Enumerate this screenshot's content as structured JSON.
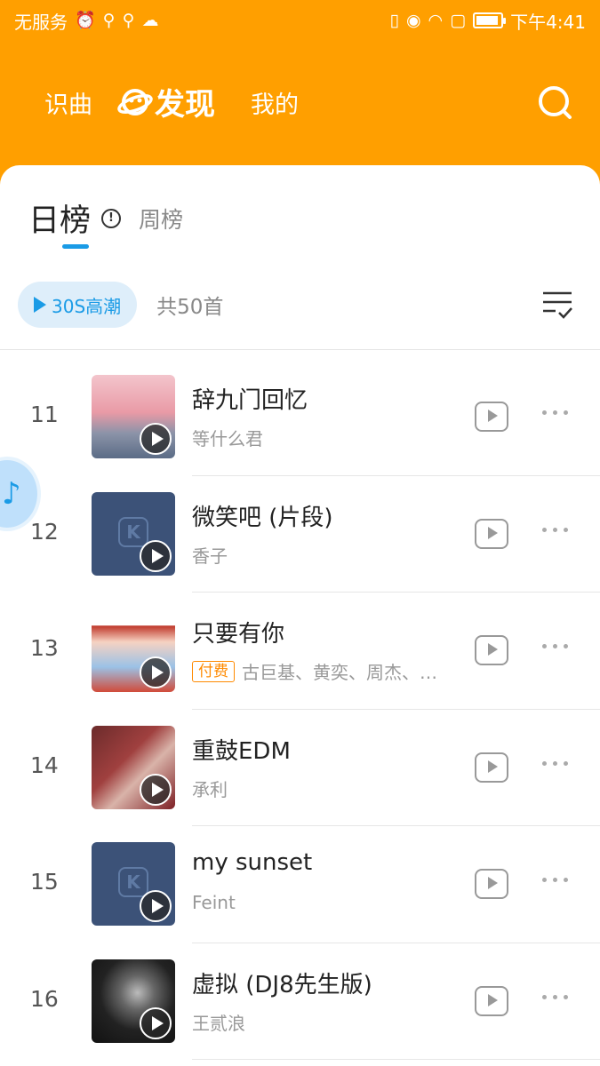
{
  "status_bar": {
    "carrier": "无服务",
    "time": "下午4:41"
  },
  "nav": {
    "recognize": "识曲",
    "discover": "发现",
    "mine": "我的"
  },
  "ranking": {
    "daily_tab": "日榜",
    "weekly_tab": "周榜",
    "hook_button": "30S高潮",
    "total": "共50首"
  },
  "songs": [
    {
      "rank": "11",
      "title": "辞九门回忆",
      "artist": "等什么君",
      "paid": "",
      "cover": "pink"
    },
    {
      "rank": "12",
      "title": "微笑吧 (片段)",
      "artist": "香子",
      "paid": "",
      "cover": "kuwo"
    },
    {
      "rank": "13",
      "title": "只要有你",
      "artist": "古巨基、黄奕、周杰、…",
      "paid": "付费",
      "cover": "poster"
    },
    {
      "rank": "14",
      "title": "重鼓EDM",
      "artist": "承利",
      "paid": "",
      "cover": "roses"
    },
    {
      "rank": "15",
      "title": "my sunset",
      "artist": "Feint",
      "paid": "",
      "cover": "kuwo"
    },
    {
      "rank": "16",
      "title": "虚拟 (DJ8先生版)",
      "artist": "王贰浪",
      "paid": "",
      "cover": "bw"
    }
  ],
  "colors": {
    "header": "#ff9f00",
    "accent": "#1a9be6",
    "paid": "#ff8a00"
  },
  "icons": {
    "search": "search-icon",
    "discover": "planet-icon",
    "multi_select": "list-check-icon",
    "mv": "video-play-icon",
    "more": "more-dots-icon"
  }
}
